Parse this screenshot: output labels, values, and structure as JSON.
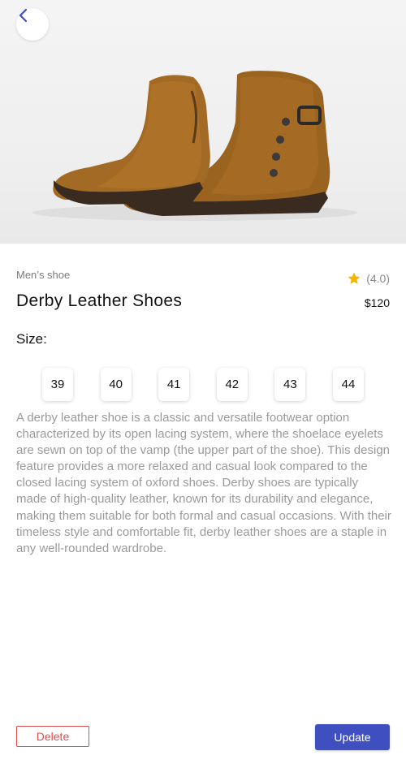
{
  "header": {
    "back_icon": "chevron-left-icon"
  },
  "product": {
    "category": "Men’s shoe",
    "rating": "(4.0)",
    "rating_value": 4.0,
    "star_color": "#f5b400",
    "title": "Derby Leather Shoes",
    "price": "$120",
    "size_label": "Size:",
    "sizes": [
      "39",
      "40",
      "41",
      "42",
      "43",
      "44"
    ],
    "description": "A derby leather shoe is a classic and versatile footwear option characterized by its open lacing system, where the shoelace eyelets are sewn on top of the vamp (the upper part of the shoe). This design feature provides a more relaxed and casual look compared to the closed lacing system of oxford shoes. Derby shoes are typically made of high-quality leather, known for its durability and elegance, making them suitable for both formal and casual occasions. With their timeless style and comfortable fit, derby leather shoes are a staple in any well-rounded wardrobe."
  },
  "actions": {
    "delete_label": "Delete",
    "update_label": "Update",
    "delete_color": "#e04b4b",
    "update_color": "#3f4fbf"
  }
}
